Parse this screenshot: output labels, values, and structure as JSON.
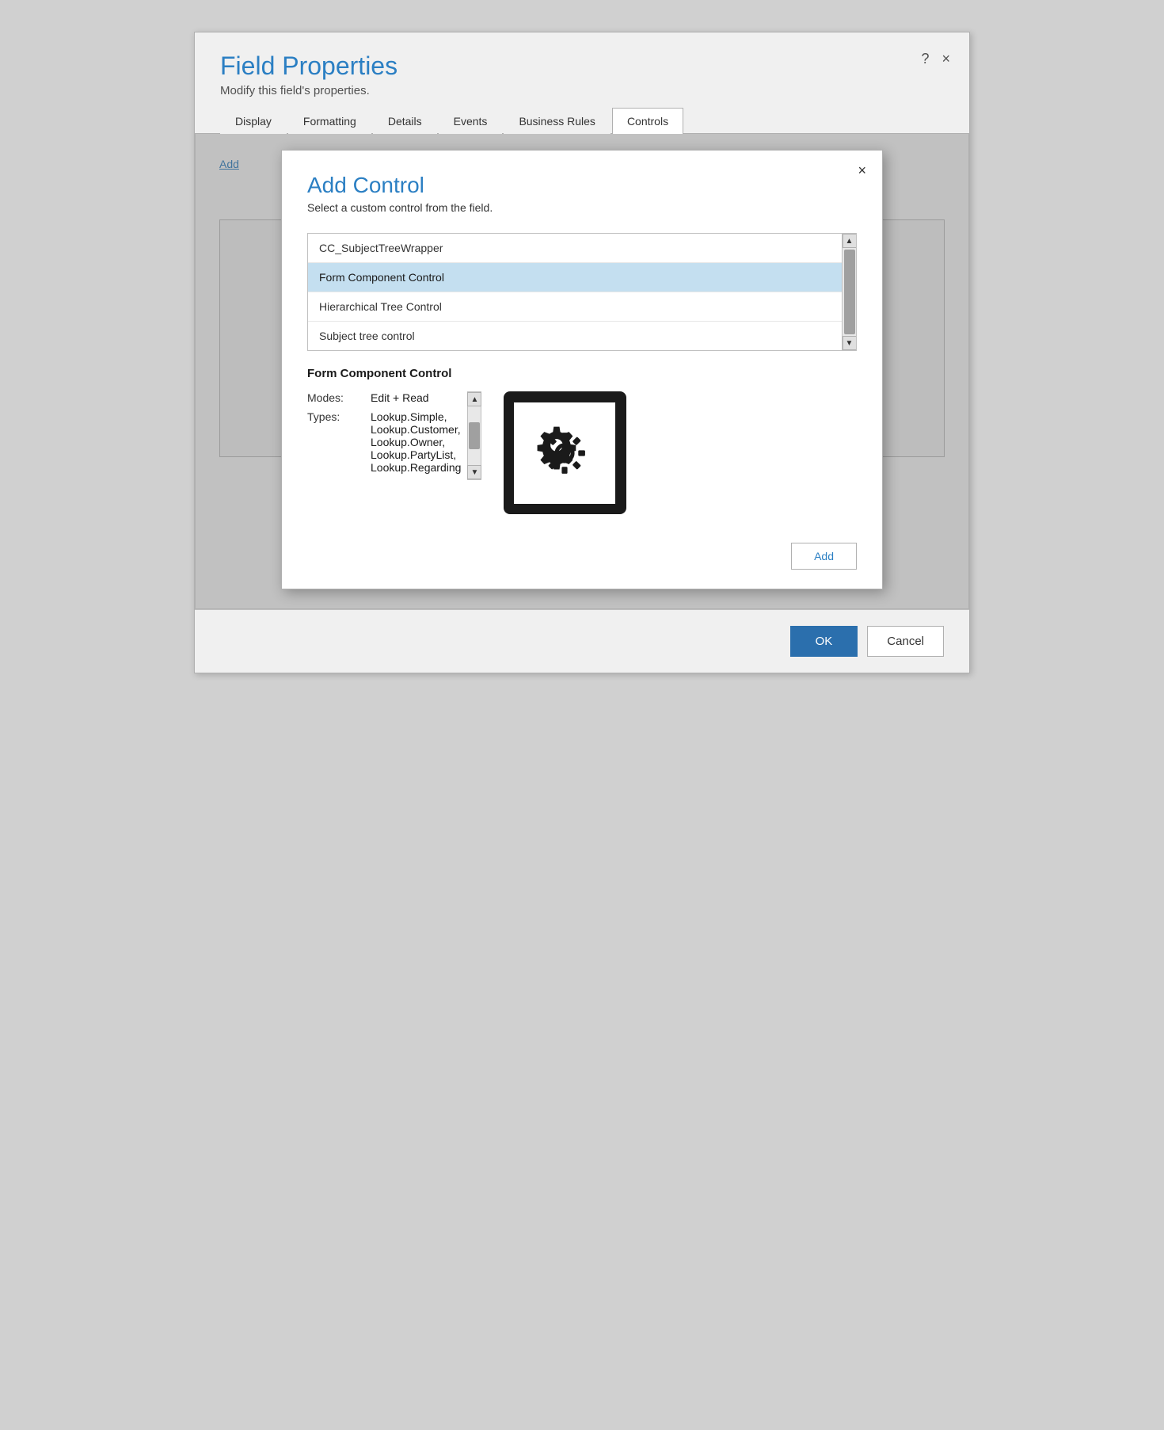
{
  "window": {
    "title": "Field Properties",
    "subtitle": "Modify this field's properties.",
    "help_btn": "?",
    "close_btn": "×"
  },
  "tabs": [
    {
      "id": "display",
      "label": "Display",
      "active": false
    },
    {
      "id": "formatting",
      "label": "Formatting",
      "active": false
    },
    {
      "id": "details",
      "label": "Details",
      "active": false
    },
    {
      "id": "events",
      "label": "Events",
      "active": false
    },
    {
      "id": "business_rules",
      "label": "Business Rules",
      "active": false
    },
    {
      "id": "controls",
      "label": "Controls",
      "active": true
    }
  ],
  "dialog": {
    "title": "Add Control",
    "subtitle": "Select a custom control from the field.",
    "close_btn": "×",
    "items": [
      {
        "id": "cc_subject",
        "label": "CC_SubjectTreeWrapper",
        "selected": false
      },
      {
        "id": "form_component",
        "label": "Form Component Control",
        "selected": true
      },
      {
        "id": "hierarchical_tree",
        "label": "Hierarchical Tree Control",
        "selected": false
      },
      {
        "id": "subject_tree",
        "label": "Subject tree control",
        "selected": false
      }
    ],
    "selected_control": {
      "name": "Form Component Control",
      "modes_label": "Modes:",
      "modes_value": "Edit + Read",
      "types_label": "Types:",
      "types_value": "Lookup.Simple,\nLookup.Customer,\nLookup.Owner,\nLookup.PartyList,\nLookup.Regarding"
    },
    "add_button_label": "Add"
  },
  "footer": {
    "ok_label": "OK",
    "cancel_label": "Cancel"
  }
}
